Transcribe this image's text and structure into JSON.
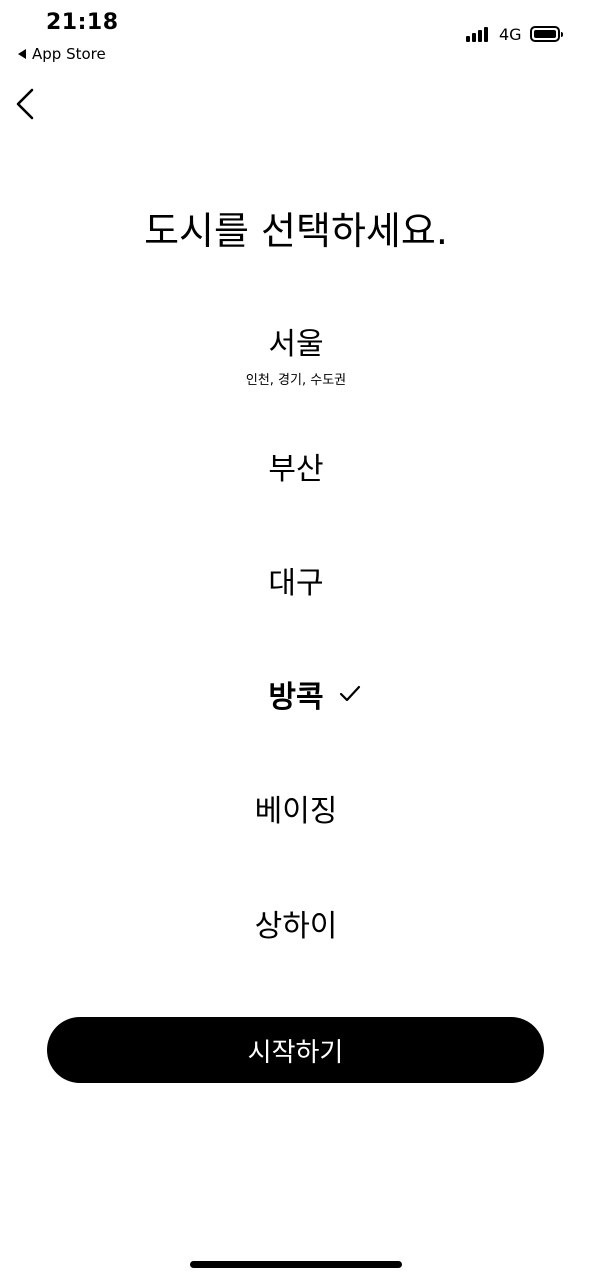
{
  "status_bar": {
    "time": "21:18",
    "back_app_label": "App Store",
    "network": "4G",
    "icons": [
      "signal-icon",
      "battery-icon"
    ]
  },
  "nav": {
    "back_icon": "chevron-left-icon"
  },
  "title": "도시를 선택하세요.",
  "cities": [
    {
      "name": "서울",
      "sub": "인천, 경기, 수도권",
      "selected": false
    },
    {
      "name": "부산",
      "selected": false
    },
    {
      "name": "대구",
      "selected": false
    },
    {
      "name": "방콕",
      "selected": true
    },
    {
      "name": "베이징",
      "selected": false
    },
    {
      "name": "상하이",
      "selected": false
    }
  ],
  "check_icon": "checkmark-icon",
  "start_button_label": "시작하기"
}
